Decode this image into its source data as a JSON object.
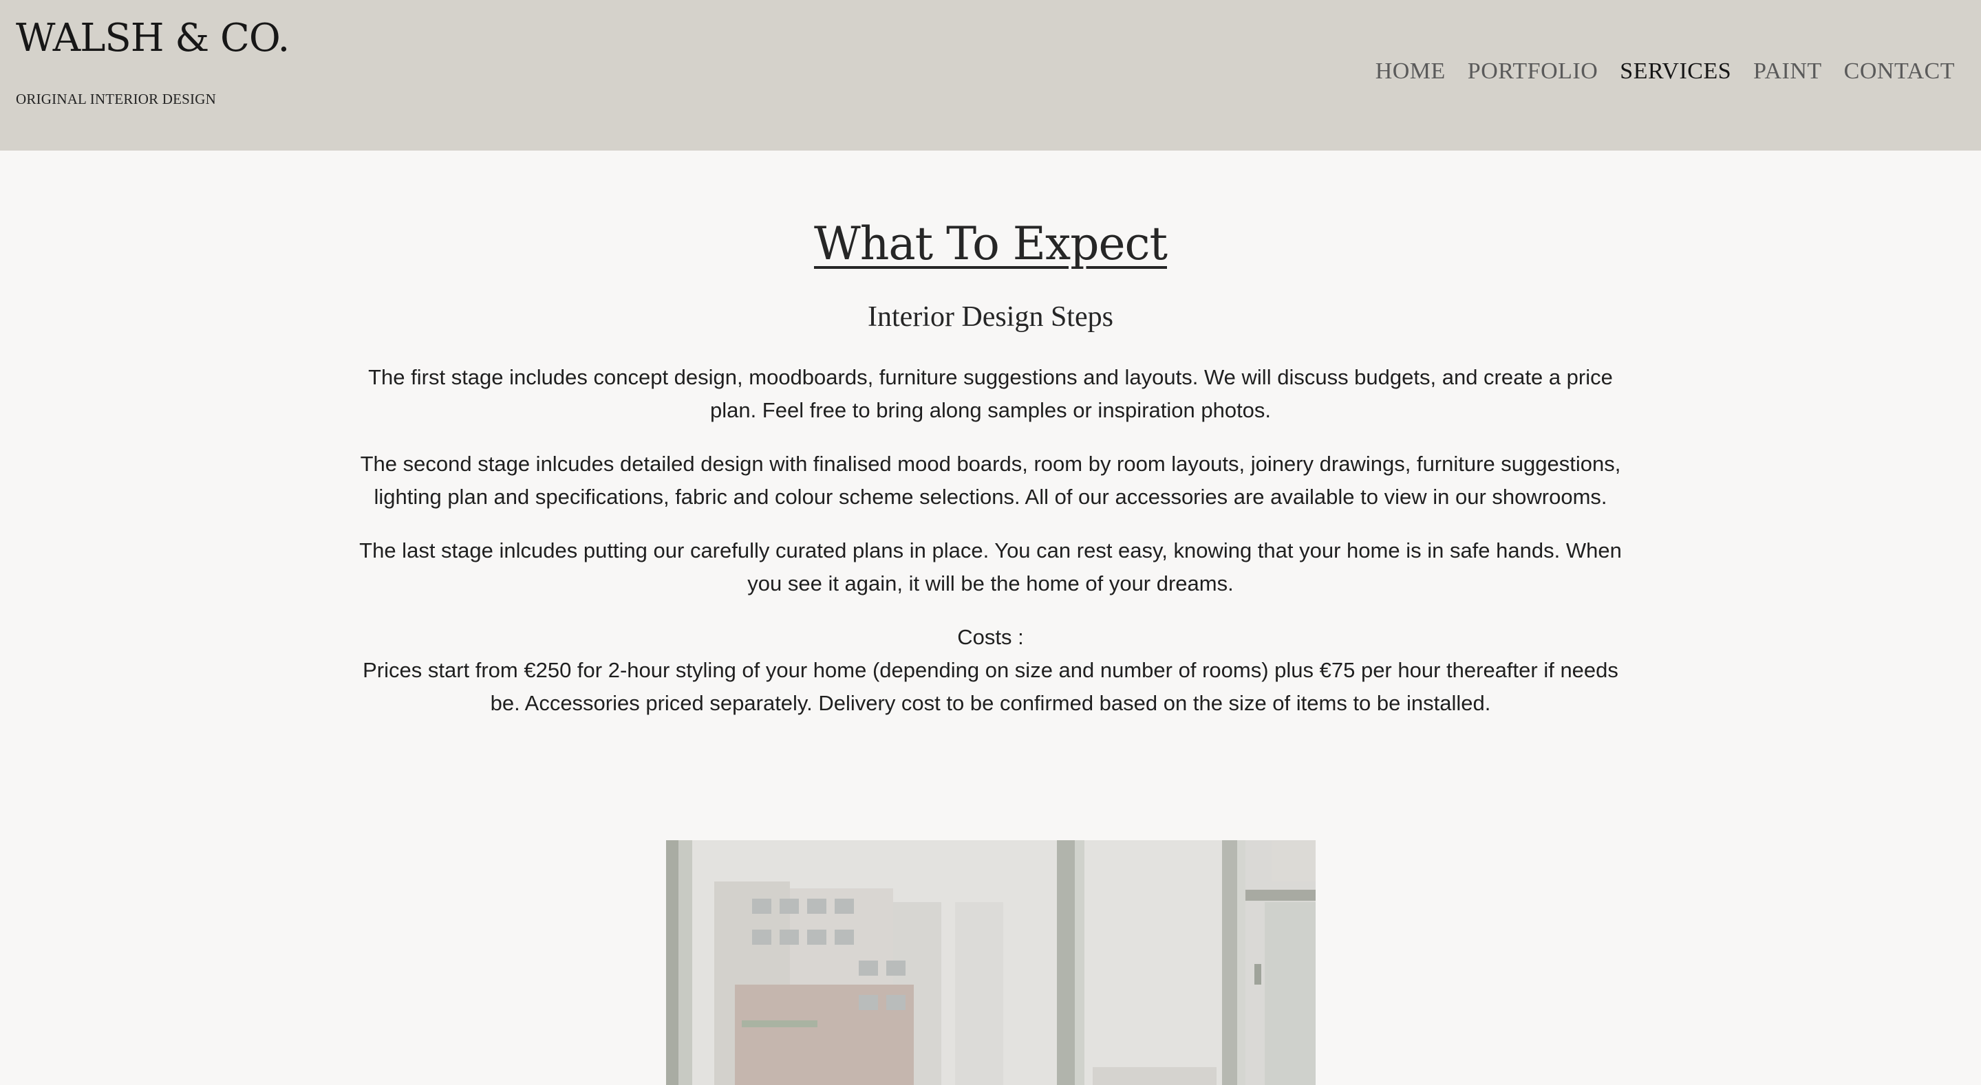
{
  "header": {
    "brand_title": "WALSH & CO.",
    "brand_subtitle": "ORIGINAL INTERIOR DESIGN",
    "nav": [
      {
        "label": "HOME",
        "active": false
      },
      {
        "label": "PORTFOLIO",
        "active": false
      },
      {
        "label": "SERVICES",
        "active": true
      },
      {
        "label": "PAINT",
        "active": false
      },
      {
        "label": "CONTACT",
        "active": false
      }
    ]
  },
  "main": {
    "title": "What To Expect",
    "subtitle": "Interior Design Steps",
    "paragraphs": [
      "The first stage includes concept design, moodboards, furniture suggestions and layouts. We will discuss budgets, and create a price plan. Feel free to bring along samples or inspiration photos.",
      "The second stage inlcudes detailed design with finalised mood boards, room by room layouts, joinery drawings, furniture suggestions, lighting plan and specifications, fabric and colour scheme selections. All of our accessories are available to view in our showrooms.",
      "The last stage inlcudes putting our carefully curated plans in place. You can rest easy, knowing that your home is in safe hands. When you see it again, it will be the home of your dreams."
    ],
    "costs_label": "Costs :",
    "costs_text": "Prices start from €250 for 2-hour styling of your home (depending on size and number of rooms) plus €75 per hour thereafter if needs be. Accessories priced separately. Delivery cost to be confirmed based on the size of items to be installed."
  },
  "colors": {
    "header_bg": "#d5d2cb",
    "page_bg": "#f8f7f6",
    "text": "#1f1f1f",
    "nav_inactive": "#5a5a5a",
    "nav_active": "#151515"
  }
}
